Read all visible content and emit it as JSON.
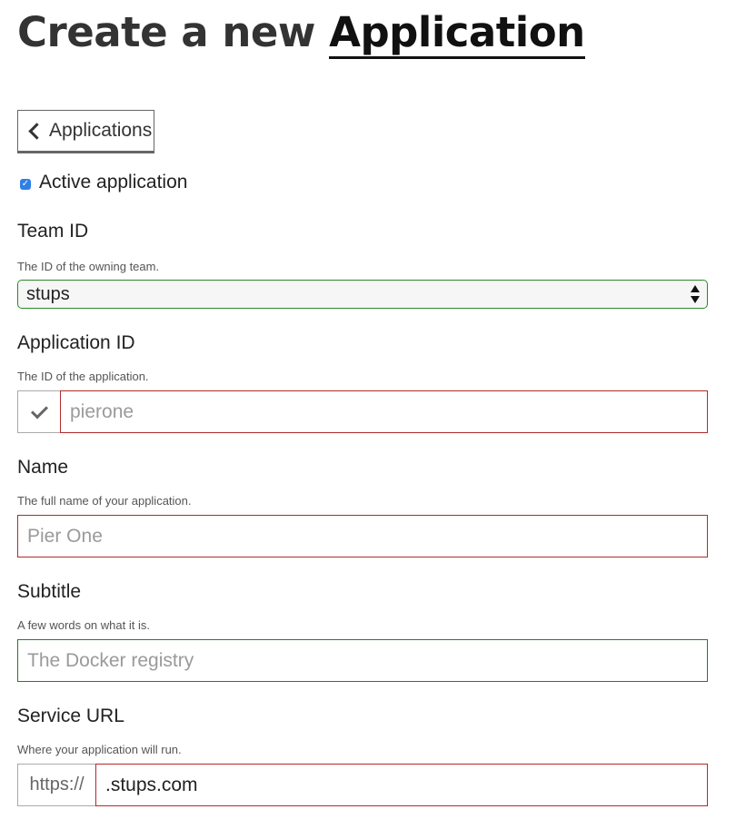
{
  "header": {
    "title_prefix": "Create a new ",
    "title_emphasis": "Application"
  },
  "back_button": {
    "label": "Applications"
  },
  "active": {
    "label": "Active application",
    "checked": true
  },
  "fields": {
    "team_id": {
      "label": "Team ID",
      "help": "The ID of the owning team.",
      "value": "stups"
    },
    "application_id": {
      "label": "Application ID",
      "help": "The ID of the application.",
      "placeholder": "pierone"
    },
    "name": {
      "label": "Name",
      "help": "The full name of your application.",
      "placeholder": "Pier One"
    },
    "subtitle": {
      "label": "Subtitle",
      "help": "A few words on what it is.",
      "placeholder": "The Docker registry"
    },
    "service_url": {
      "label": "Service URL",
      "help": "Where your application will run.",
      "prefix": "https://",
      "value": ".stups.com"
    }
  },
  "colors": {
    "valid_border": "#2a8a2a",
    "invalid_border": "#b22a2a",
    "checkbox": "#2f7fe8"
  }
}
